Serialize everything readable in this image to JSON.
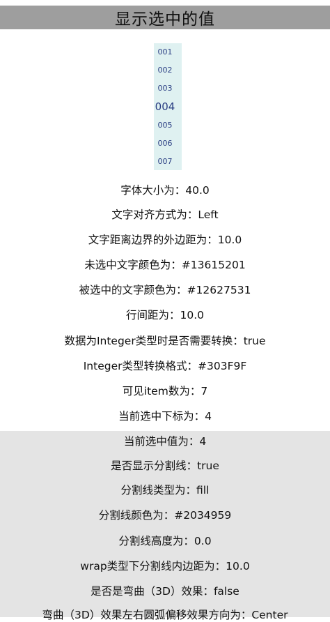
{
  "header": {
    "title": "显示选中的值"
  },
  "wheel": {
    "items": [
      "001",
      "002",
      "003",
      "004",
      "005",
      "006",
      "007"
    ],
    "selected_index": 3
  },
  "info": [
    "字体大小为：40.0",
    "文字对齐方式为：Left",
    "文字距离边界的外边距为：10.0",
    "未选中文字颜色为：#13615201",
    "被选中的文字颜色为：#12627531",
    "行间距为：10.0",
    "数据为Integer类型时是否需要转换：true",
    "Integer类型转换格式：#303F9F",
    "可见item数为：7",
    "当前选中下标为：4",
    "当前选中值为：4",
    "是否显示分割线：true",
    "分割线类型为：fill",
    "分割线颜色为：#2034959",
    "分割线高度为：0.0",
    "wrap类型下分割线内边距为：10.0",
    "是否是弯曲（3D）效果：false",
    "弯曲（3D）效果左右圆弧偏移效果方向为：Center"
  ],
  "colors": {
    "title_bar": "#9e9e9e",
    "wheel_background": "#dff1f1",
    "wheel_text": "#2a3e83",
    "lower_panel": "#e4e4e4"
  }
}
